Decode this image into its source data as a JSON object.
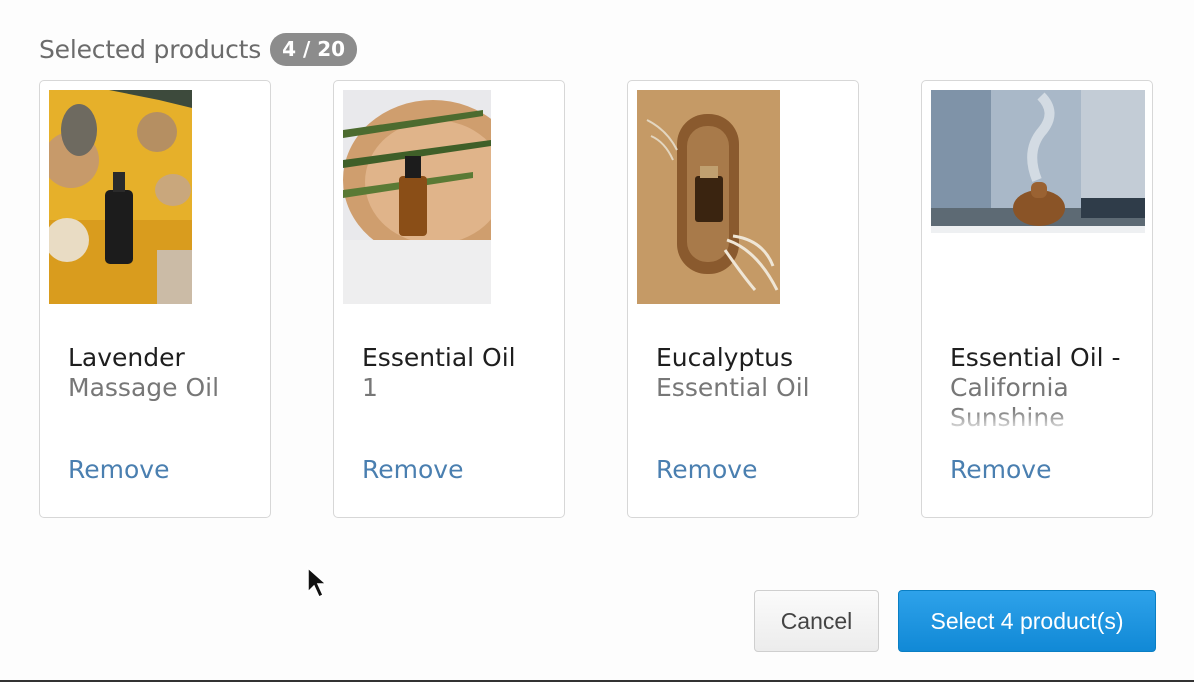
{
  "header": {
    "title": "Selected products",
    "count": "4 / 20"
  },
  "products": [
    {
      "name_line1": "Lavender",
      "name_line2": "Massage Oil",
      "remove_label": "Remove",
      "image": "lavender-massage-oil-photo"
    },
    {
      "name_line1": "Essential Oil",
      "name_line2": "1",
      "remove_label": "Remove",
      "image": "essential-oil-bottle-photo"
    },
    {
      "name_line1": "Eucalyptus",
      "name_line2": "Essential Oil",
      "remove_label": "Remove",
      "image": "eucalyptus-oil-photo"
    },
    {
      "name_line1": "Essential Oil -",
      "name_line2": "California Sunshine",
      "remove_label": "Remove",
      "image": "oil-diffuser-photo"
    }
  ],
  "footer": {
    "cancel_label": "Cancel",
    "select_label": "Select 4 product(s)"
  },
  "colors": {
    "link": "#4a7fb0",
    "primary_button": "#1a90dc",
    "badge": "#8c8c8c"
  }
}
